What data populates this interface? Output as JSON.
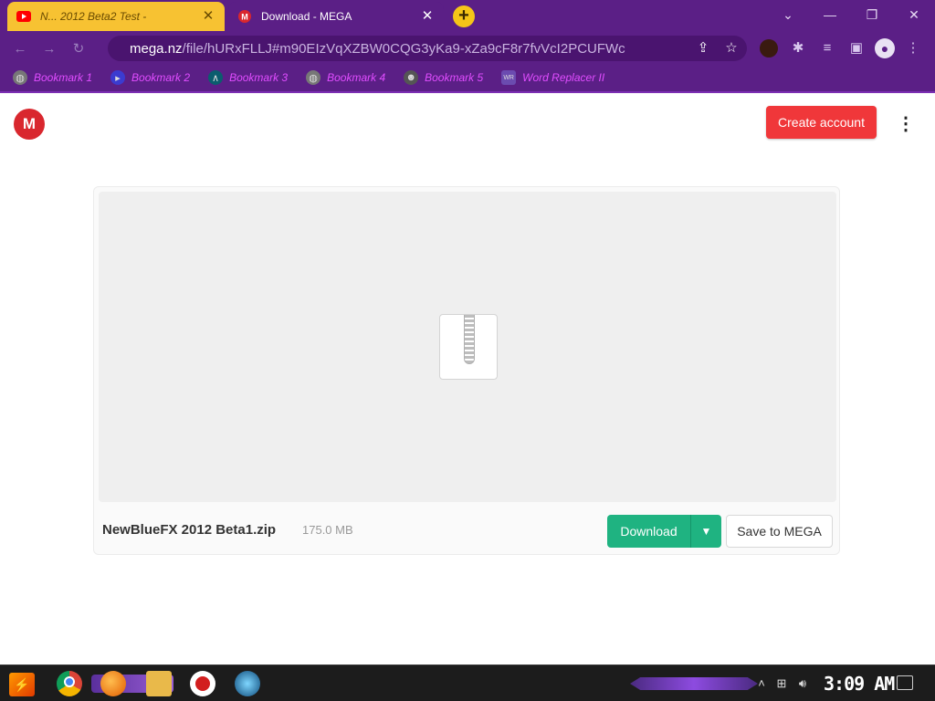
{
  "browser": {
    "tabs": [
      {
        "title": "N... 2012 Beta2 Test -",
        "favicon": "youtube-icon",
        "active": false
      },
      {
        "title": "Download - MEGA",
        "favicon": "mega-icon",
        "active": true
      }
    ],
    "new_tab_label": "+",
    "url_host": "mega.nz",
    "url_path": "/file/hURxFLLJ#m90EIzVqXZBW0CQG3yKa9-xZa9cF8r7fvVcI2PCUFWc",
    "bookmarks": [
      {
        "label": "Bookmark 1",
        "icon": "globe-icon"
      },
      {
        "label": "Bookmark 2",
        "icon": "bookmark-icon"
      },
      {
        "label": "Bookmark 3",
        "icon": "bookmark-icon"
      },
      {
        "label": "Bookmark 4",
        "icon": "globe-icon"
      },
      {
        "label": "Bookmark 5",
        "icon": "bookmark-icon"
      },
      {
        "label": "Word Replacer II",
        "icon": "extension-icon"
      }
    ],
    "theme_color": "#5b1f86"
  },
  "mega": {
    "logo_letter": "M",
    "create_account": "Create account",
    "file_name": "NewBlueFX 2012 Beta1.zip",
    "file_size": "175.0 MB",
    "download_label": "Download",
    "save_label": "Save to MEGA",
    "accent_red": "#d9272e",
    "accent_green": "#1fb381"
  },
  "taskbar": {
    "clock": "3:09 AM"
  }
}
